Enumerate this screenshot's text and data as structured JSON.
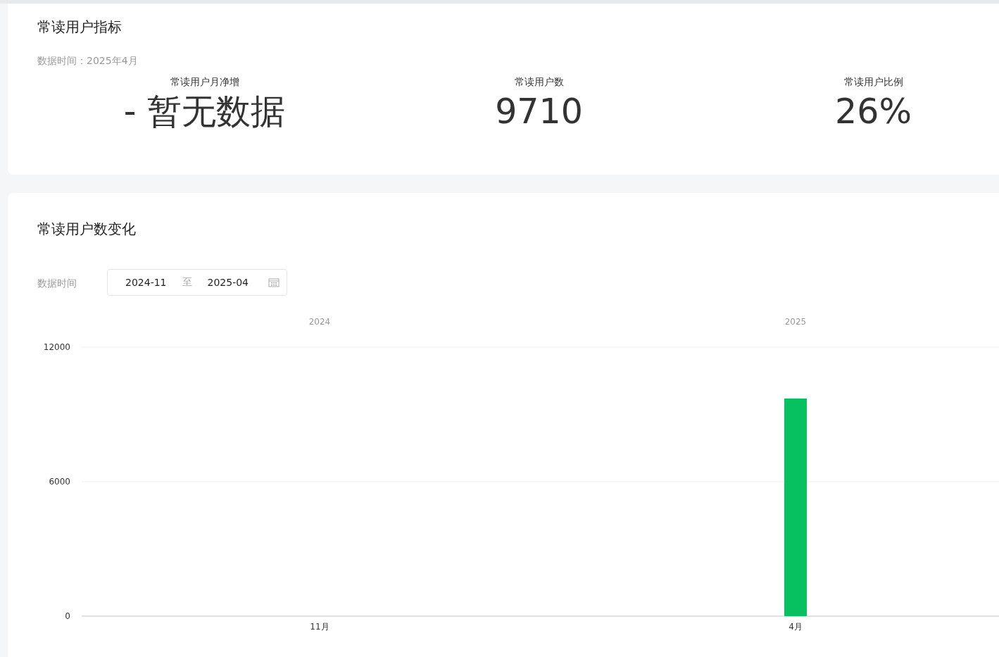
{
  "metrics_card": {
    "title": "常读用户指标",
    "data_time": "数据时间：2025年4月",
    "metrics": [
      {
        "label": "常读用户月净增",
        "value": "- 暂无数据"
      },
      {
        "label": "常读用户数",
        "value": "9710"
      },
      {
        "label": "常读用户比例",
        "value": "26%"
      }
    ]
  },
  "trend_card": {
    "title": "常读用户数变化",
    "filter_label": "数据时间",
    "start_date": "2024-11",
    "separator": "至",
    "end_date": "2025-04",
    "chart_data": {
      "type": "bar",
      "categories": [
        "11月",
        "4月"
      ],
      "values": [
        null,
        9710
      ],
      "ylim": [
        0,
        12000
      ],
      "yticks": [
        0,
        6000,
        12000
      ],
      "annotations": [
        "2024",
        "2025"
      ]
    }
  }
}
